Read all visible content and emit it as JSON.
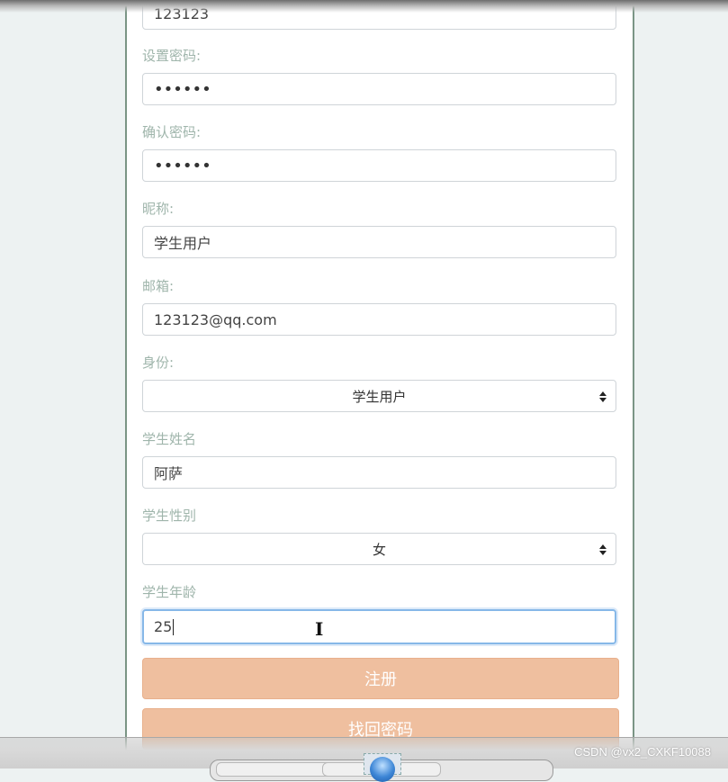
{
  "form": {
    "top_field_value": "123123",
    "password": {
      "label": "设置密码:",
      "value": "••••••"
    },
    "confirm_password": {
      "label": "确认密码:",
      "value": "••••••"
    },
    "nickname": {
      "label": "昵称:",
      "value": "学生用户"
    },
    "email": {
      "label": "邮箱:",
      "value": "123123@qq.com"
    },
    "identity": {
      "label": "身份:",
      "selected": "学生用户"
    },
    "student_name": {
      "label": "学生姓名",
      "value": "阿萨"
    },
    "student_gender": {
      "label": "学生性别",
      "selected": "女"
    },
    "student_age": {
      "label": "学生年龄",
      "value": "25"
    },
    "register_button": "注册",
    "recover_password_button": "找回密码"
  },
  "mouse_cursor_glyph": "I",
  "watermark": "CSDN @vx2_CXKF10088",
  "colors": {
    "page_background": "#edf2f2",
    "panel_border": "#7a9585",
    "label_text": "#9fb5ab",
    "button_background": "#efbf9f",
    "focus_border": "#86b8e8"
  }
}
